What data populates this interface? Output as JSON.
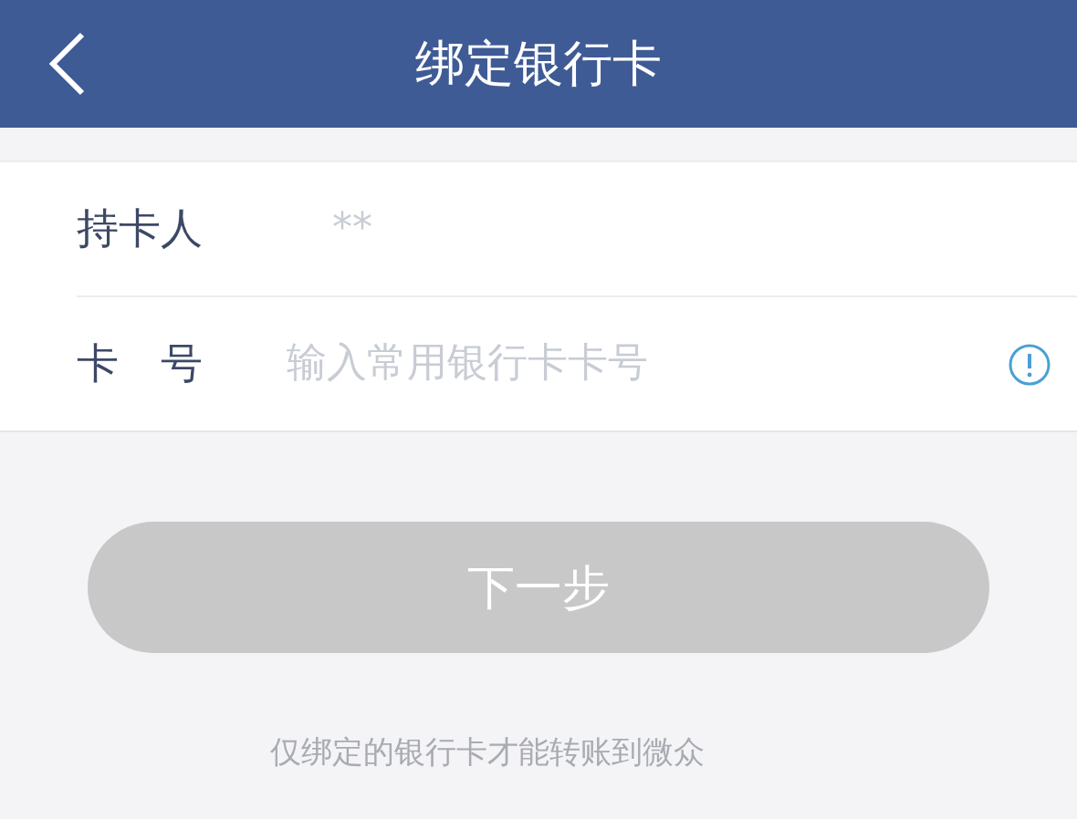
{
  "header": {
    "title": "绑定银行卡"
  },
  "form": {
    "fields": [
      {
        "kind": "text",
        "label": "持卡人",
        "value": "**"
      },
      {
        "kind": "card",
        "label": "卡　号",
        "placeholder": "输入常用银行卡卡号"
      }
    ]
  },
  "button": {
    "label": "下一步",
    "disabled": true
  },
  "note": "仅绑定的银行卡才能转账到微众"
}
